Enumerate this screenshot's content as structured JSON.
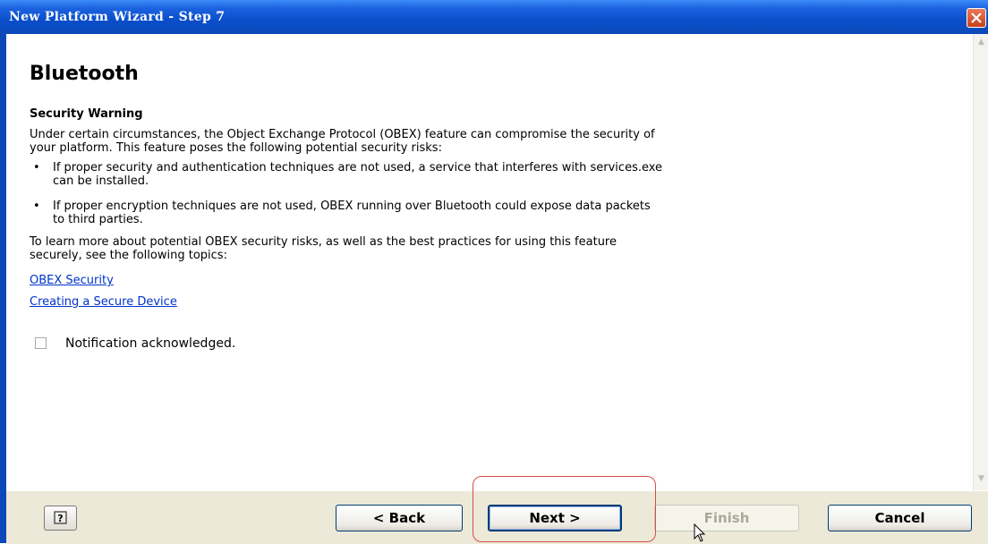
{
  "window": {
    "title": "New Platform Wizard - Step 7"
  },
  "page": {
    "heading": "Bluetooth",
    "section_title": "Security Warning",
    "intro_line1": "Under certain circumstances, the Object Exchange Protocol (OBEX) feature can compromise the security of",
    "intro_line2": "your platform. This feature poses the following potential security risks:",
    "bullets": [
      {
        "dot": "•",
        "line1": "If proper security and authentication techniques are not used, a service that interferes with services.exe",
        "line2": "can be installed."
      },
      {
        "dot": "•",
        "line1": "If proper encryption techniques are not used, OBEX running over Bluetooth could expose data packets",
        "line2": "to third parties."
      }
    ],
    "learn_line1": "To learn more about potential OBEX security risks, as well as the best practices for using this feature",
    "learn_line2": "securely, see the following topics:",
    "links": [
      "OBEX Security",
      "Creating a Secure Device"
    ],
    "checkbox_label": "Notification acknowledged.",
    "checkbox_checked": false
  },
  "footer": {
    "help_icon": "question-mark-icon",
    "back_label": "< Back",
    "next_label": "Next >",
    "finish_label": "Finish",
    "cancel_label": "Cancel"
  },
  "colors": {
    "titlebar": "#0b4ec9",
    "link": "#0033cc",
    "highlight": "#d94b4b"
  }
}
